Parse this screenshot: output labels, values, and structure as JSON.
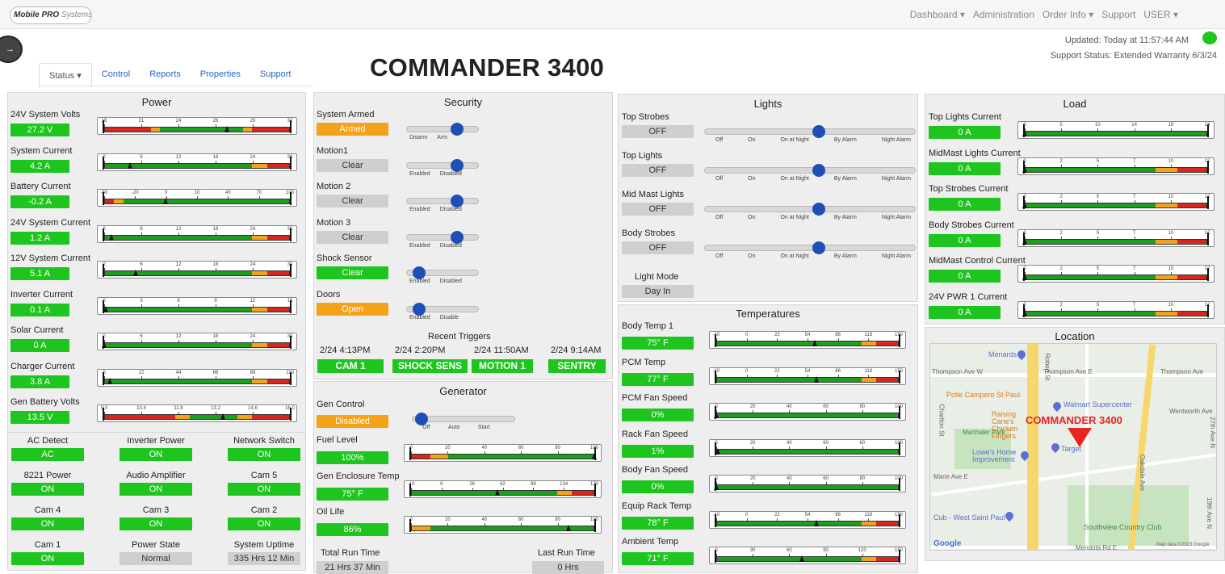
{
  "brand": {
    "logo_text": "Mobile PRO",
    "logo_sub": "Systems"
  },
  "topnav": [
    "Dashboard ▾",
    "Administration",
    "Order Info ▾",
    "Support",
    "USER ▾"
  ],
  "tabs": [
    "Status ▾",
    "Control",
    "Reports",
    "Properties",
    "Support"
  ],
  "page_title": "COMMANDER 3400",
  "status": {
    "updated": "Updated: Today at 11:57:44 AM",
    "support_status": "Support Status: Extended Warranty 6/3/24"
  },
  "colors": {
    "green": "#1fc51f",
    "orange": "#f5a21b",
    "red": "#d9261c",
    "bar_green": "#1e9e1e",
    "knob": "#1f4fb5"
  },
  "power": {
    "title": "Power",
    "gauges": [
      {
        "label": "24V System Volts",
        "value": "27.2 V",
        "ticks": [
          "18",
          "21",
          "24",
          "26",
          "29",
          "32"
        ],
        "level": 0.66
      },
      {
        "label": "System Current",
        "value": "4.2 A",
        "ticks": [
          "0",
          "6",
          "12",
          "18",
          "24",
          "30"
        ],
        "level": 0.14
      },
      {
        "label": "Battery Current",
        "value": "-0.2 A",
        "ticks": [
          "-50",
          "-20",
          "0",
          "10",
          "40",
          "70",
          "100"
        ],
        "level": 0.33
      },
      {
        "label": "24V System Current",
        "value": "1.2 A",
        "ticks": [
          "0",
          "6",
          "12",
          "18",
          "24",
          "30"
        ],
        "level": 0.04
      },
      {
        "label": "12V System Current",
        "value": "5.1 A",
        "ticks": [
          "0",
          "6",
          "12",
          "18",
          "24",
          "30"
        ],
        "level": 0.17
      },
      {
        "label": "Inverter Current",
        "value": "0.1 A",
        "ticks": [
          "0",
          "3",
          "6",
          "9",
          "12",
          "15"
        ],
        "level": 0.01
      },
      {
        "label": "Solar Current",
        "value": "0 A",
        "ticks": [
          "0",
          "6",
          "12",
          "18",
          "24",
          "30"
        ],
        "level": 0.0
      },
      {
        "label": "Charger Current",
        "value": "3.8 A",
        "ticks": [
          "0",
          "22",
          "44",
          "66",
          "88",
          "110"
        ],
        "level": 0.03
      },
      {
        "label": "Gen Battery Volts",
        "value": "13.5 V",
        "ticks": [
          "9.0",
          "10.4",
          "11.8",
          "13.2",
          "14.6",
          "16.0"
        ],
        "level": 0.64
      }
    ],
    "statuses": [
      {
        "label": "AC Detect",
        "value": "AC",
        "color": "green"
      },
      {
        "label": "Inverter Power",
        "value": "ON",
        "color": "green"
      },
      {
        "label": "Network Switch",
        "value": "ON",
        "color": "green"
      },
      {
        "label": "8221 Power",
        "value": "ON",
        "color": "green"
      },
      {
        "label": "Audio Amplifier",
        "value": "ON",
        "color": "green"
      },
      {
        "label": "Cam 5",
        "value": "ON",
        "color": "green"
      },
      {
        "label": "Cam 4",
        "value": "ON",
        "color": "green"
      },
      {
        "label": "Cam 3",
        "value": "ON",
        "color": "green"
      },
      {
        "label": "Cam 2",
        "value": "ON",
        "color": "green"
      },
      {
        "label": "Cam 1",
        "value": "ON",
        "color": "green"
      },
      {
        "label": "Power State",
        "value": "Normal",
        "color": "gray"
      },
      {
        "label": "System Uptime",
        "value": "335 Hrs 12 Min",
        "color": "gray"
      }
    ]
  },
  "security": {
    "title": "Security",
    "items": [
      {
        "label": "System Armed",
        "value": "Armed",
        "color": "orange",
        "options": [
          "Disarm",
          "Arm"
        ],
        "position": 1
      },
      {
        "label": "Motion1",
        "value": "Clear",
        "color": "gray",
        "options": [
          "Enabled",
          "Disabled"
        ],
        "position": 1
      },
      {
        "label": "Motion 2",
        "value": "Clear",
        "color": "gray",
        "options": [
          "Enabled",
          "Disabled"
        ],
        "position": 1
      },
      {
        "label": "Motion 3",
        "value": "Clear",
        "color": "gray",
        "options": [
          "Enabled",
          "Disabled"
        ],
        "position": 1
      },
      {
        "label": "Shock Sensor",
        "value": "Clear",
        "color": "green",
        "options": [
          "Enabled",
          "Disabled"
        ],
        "position": 0
      },
      {
        "label": "Doors",
        "value": "Open",
        "color": "orange",
        "options": [
          "Enabled",
          "Disable"
        ],
        "position": 0
      }
    ],
    "recent_title": "Recent Triggers",
    "triggers": [
      {
        "date": "2/24 4:13PM",
        "name": "CAM 1"
      },
      {
        "date": "2/24 2:20PM",
        "name": "SHOCK SENS"
      },
      {
        "date": "2/24 11:50AM",
        "name": "MOTION 1"
      },
      {
        "date": "2/24 9:14AM",
        "name": "SENTRY"
      }
    ]
  },
  "generator": {
    "title": "Generator",
    "control_label": "Gen Control",
    "control_value": "Disabled",
    "control_options": [
      "Off",
      "Auto",
      "Start"
    ],
    "control_position": 0,
    "gauges": [
      {
        "label": "Fuel Level",
        "value": "100%",
        "ticks": [
          "0",
          "20",
          "40",
          "60",
          "80",
          "100"
        ],
        "level": 1.0
      },
      {
        "label": "Gen Enclosure Temp",
        "value": "75° F",
        "ticks": [
          "-10",
          "0",
          "26",
          "62",
          "98",
          "134",
          "170"
        ],
        "level": 0.47
      },
      {
        "label": "Oil Life",
        "value": "86%",
        "ticks": [
          "0",
          "20",
          "40",
          "60",
          "80",
          "100"
        ],
        "level": 0.86
      }
    ],
    "total_run_label": "Total Run Time",
    "total_run_value": "21 Hrs 37 Min",
    "last_run_label": "Last Run Time",
    "last_run_value": "0 Hrs"
  },
  "lights": {
    "title": "Lights",
    "options": [
      "Off",
      "On",
      "On at Night",
      "By Alarm",
      "Night Alarm"
    ],
    "items": [
      {
        "label": "Top Strobes",
        "value": "OFF",
        "position": 3
      },
      {
        "label": "Top Lights",
        "value": "OFF",
        "position": 3
      },
      {
        "label": "Mid Mast Lights",
        "value": "OFF",
        "position": 3
      },
      {
        "label": "Body Strobes",
        "value": "OFF",
        "position": 3
      }
    ],
    "mode_label": "Light Mode",
    "mode_value": "Day In"
  },
  "temperatures": {
    "title": "Temperatures",
    "gauges": [
      {
        "label": "Body Temp 1",
        "value": "75° F",
        "ticks": [
          "-10",
          "0",
          "22",
          "54",
          "86",
          "118",
          "150"
        ],
        "level": 0.54
      },
      {
        "label": "PCM Temp",
        "value": "77° F",
        "ticks": [
          "-10",
          "0",
          "22",
          "54",
          "86",
          "118",
          "150"
        ],
        "level": 0.55
      },
      {
        "label": "PCM Fan Speed",
        "value": "0%",
        "ticks": [
          "0",
          "20",
          "40",
          "60",
          "80",
          "100"
        ],
        "level": 0.0
      },
      {
        "label": "Rack Fan Speed",
        "value": "1%",
        "ticks": [
          "0",
          "20",
          "40",
          "60",
          "80",
          "100"
        ],
        "level": 0.01
      },
      {
        "label": "Body Fan Speed",
        "value": "0%",
        "ticks": [
          "0",
          "20",
          "40",
          "60",
          "80",
          "100"
        ],
        "level": 0.0
      },
      {
        "label": "Equip Rack Temp",
        "value": "78° F",
        "ticks": [
          "-10",
          "0",
          "22",
          "54",
          "86",
          "118",
          "150"
        ],
        "level": 0.55
      },
      {
        "label": "Ambient Temp",
        "value": "71° F",
        "ticks": [
          "0",
          "30",
          "60",
          "90",
          "120",
          "150"
        ],
        "level": 0.47
      }
    ]
  },
  "load": {
    "title": "Load",
    "gauges": [
      {
        "label": "Top Lights Current",
        "value": "0 A",
        "ticks": [
          "0",
          "5",
          "10",
          "14",
          "19",
          "24"
        ],
        "level": 0.0
      },
      {
        "label": "MidMast Lights Current",
        "value": "0 A",
        "ticks": [
          "0",
          "2",
          "5",
          "7",
          "10",
          "12"
        ],
        "level": 0.0
      },
      {
        "label": "Top Strobes Current",
        "value": "0 A",
        "ticks": [
          "0",
          "2",
          "5",
          "7",
          "10",
          "12"
        ],
        "level": 0.0
      },
      {
        "label": "Body Strobes Current",
        "value": "0 A",
        "ticks": [
          "0",
          "2",
          "5",
          "7",
          "10",
          "12"
        ],
        "level": 0.0
      },
      {
        "label": "MidMast Control Current",
        "value": "0 A",
        "ticks": [
          "0",
          "2",
          "5",
          "7",
          "10",
          "12"
        ],
        "level": 0.0
      },
      {
        "label": "24V PWR 1 Current",
        "value": "0 A",
        "ticks": [
          "0",
          "2",
          "5",
          "7",
          "10",
          "12"
        ],
        "level": 0.0
      }
    ]
  },
  "location": {
    "title": "Location",
    "marker_label": "COMMANDER 3400",
    "places": [
      "Menards",
      "Polle Campero St Paul",
      "Raising Cane's Chicken Fingers",
      "Walmart Supercenter",
      "Marthaler Park",
      "Lowe's Home Improvement",
      "Target",
      "Cub - West Saint Paul",
      "Southview Country Club"
    ],
    "streets": [
      "Thompson Ave W",
      "Thompson Ave E",
      "Thompson Ave",
      "Wentworth Ave",
      "Robert St",
      "Oakdale Ave",
      "Charlton St",
      "Marie Ave E",
      "Mendota Rd E",
      "19th Ave N",
      "27th Ave N"
    ],
    "google": "Google",
    "map_credit": "Map data ©2023 Google"
  }
}
